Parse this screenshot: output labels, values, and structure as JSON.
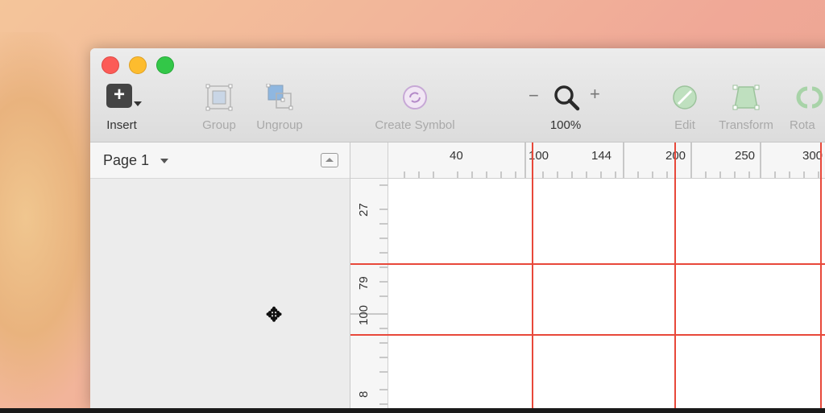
{
  "toolbar": {
    "insert_label": "Insert",
    "group_label": "Group",
    "ungroup_label": "Ungroup",
    "create_symbol_label": "Create Symbol",
    "zoom_minus": "−",
    "zoom_plus": "+",
    "zoom_level": "100%",
    "edit_label": "Edit",
    "transform_label": "Transform",
    "rotate_label": "Rota"
  },
  "sidebar": {
    "page_label": "Page 1"
  },
  "ruler": {
    "horizontal_labels": [
      "40",
      "100",
      "144",
      "200",
      "250",
      "300"
    ],
    "vertical_labels": [
      "27",
      "79",
      "100",
      "8"
    ]
  },
  "colors": {
    "guide": "#e8483a",
    "insert_bg": "#444444"
  },
  "icons": {
    "insert": "plus-square-icon",
    "group": "group-icon",
    "ungroup": "ungroup-icon",
    "create_symbol": "symbol-icon",
    "zoom": "magnifier-icon",
    "edit": "edit-icon",
    "transform": "transform-icon",
    "rotate": "rotate-icon",
    "cursor": "resize-vertical-cursor-icon"
  }
}
